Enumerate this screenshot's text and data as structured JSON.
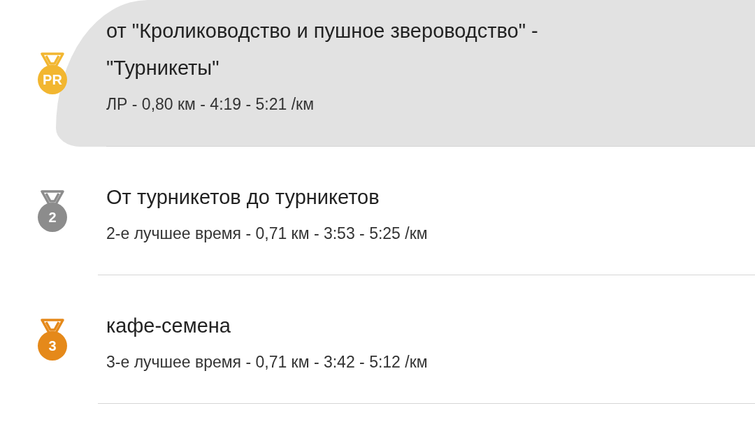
{
  "segments": [
    {
      "medal": "PR",
      "color": "#f2b630",
      "selected": true,
      "title": "от \"Кролиководство и пушное звероводство\" - \"Турникеты\"",
      "details": "ЛР - 0,80 км - 4:19 - 5:21 /км"
    },
    {
      "medal": "2",
      "color": "#8c8c8c",
      "selected": false,
      "title": "От турникетов до турникетов",
      "details": "2-е лучшее время - 0,71 км - 3:53 - 5:25 /км"
    },
    {
      "medal": "3",
      "color": "#e5891a",
      "selected": false,
      "title": "кафе-семена",
      "details": "3-е лучшее время - 0,71 км - 3:42 - 5:12 /км"
    }
  ]
}
